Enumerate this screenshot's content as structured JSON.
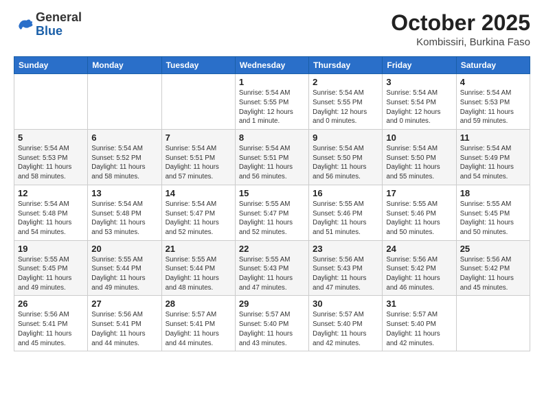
{
  "header": {
    "logo_general": "General",
    "logo_blue": "Blue",
    "month_title": "October 2025",
    "location": "Kombissiri, Burkina Faso"
  },
  "weekdays": [
    "Sunday",
    "Monday",
    "Tuesday",
    "Wednesday",
    "Thursday",
    "Friday",
    "Saturday"
  ],
  "weeks": [
    [
      {
        "day": "",
        "sunrise": "",
        "sunset": "",
        "daylight": ""
      },
      {
        "day": "",
        "sunrise": "",
        "sunset": "",
        "daylight": ""
      },
      {
        "day": "",
        "sunrise": "",
        "sunset": "",
        "daylight": ""
      },
      {
        "day": "1",
        "sunrise": "Sunrise: 5:54 AM",
        "sunset": "Sunset: 5:55 PM",
        "daylight": "Daylight: 12 hours and 1 minute."
      },
      {
        "day": "2",
        "sunrise": "Sunrise: 5:54 AM",
        "sunset": "Sunset: 5:55 PM",
        "daylight": "Daylight: 12 hours and 0 minutes."
      },
      {
        "day": "3",
        "sunrise": "Sunrise: 5:54 AM",
        "sunset": "Sunset: 5:54 PM",
        "daylight": "Daylight: 12 hours and 0 minutes."
      },
      {
        "day": "4",
        "sunrise": "Sunrise: 5:54 AM",
        "sunset": "Sunset: 5:53 PM",
        "daylight": "Daylight: 11 hours and 59 minutes."
      }
    ],
    [
      {
        "day": "5",
        "sunrise": "Sunrise: 5:54 AM",
        "sunset": "Sunset: 5:53 PM",
        "daylight": "Daylight: 11 hours and 58 minutes."
      },
      {
        "day": "6",
        "sunrise": "Sunrise: 5:54 AM",
        "sunset": "Sunset: 5:52 PM",
        "daylight": "Daylight: 11 hours and 58 minutes."
      },
      {
        "day": "7",
        "sunrise": "Sunrise: 5:54 AM",
        "sunset": "Sunset: 5:51 PM",
        "daylight": "Daylight: 11 hours and 57 minutes."
      },
      {
        "day": "8",
        "sunrise": "Sunrise: 5:54 AM",
        "sunset": "Sunset: 5:51 PM",
        "daylight": "Daylight: 11 hours and 56 minutes."
      },
      {
        "day": "9",
        "sunrise": "Sunrise: 5:54 AM",
        "sunset": "Sunset: 5:50 PM",
        "daylight": "Daylight: 11 hours and 56 minutes."
      },
      {
        "day": "10",
        "sunrise": "Sunrise: 5:54 AM",
        "sunset": "Sunset: 5:50 PM",
        "daylight": "Daylight: 11 hours and 55 minutes."
      },
      {
        "day": "11",
        "sunrise": "Sunrise: 5:54 AM",
        "sunset": "Sunset: 5:49 PM",
        "daylight": "Daylight: 11 hours and 54 minutes."
      }
    ],
    [
      {
        "day": "12",
        "sunrise": "Sunrise: 5:54 AM",
        "sunset": "Sunset: 5:48 PM",
        "daylight": "Daylight: 11 hours and 54 minutes."
      },
      {
        "day": "13",
        "sunrise": "Sunrise: 5:54 AM",
        "sunset": "Sunset: 5:48 PM",
        "daylight": "Daylight: 11 hours and 53 minutes."
      },
      {
        "day": "14",
        "sunrise": "Sunrise: 5:54 AM",
        "sunset": "Sunset: 5:47 PM",
        "daylight": "Daylight: 11 hours and 52 minutes."
      },
      {
        "day": "15",
        "sunrise": "Sunrise: 5:55 AM",
        "sunset": "Sunset: 5:47 PM",
        "daylight": "Daylight: 11 hours and 52 minutes."
      },
      {
        "day": "16",
        "sunrise": "Sunrise: 5:55 AM",
        "sunset": "Sunset: 5:46 PM",
        "daylight": "Daylight: 11 hours and 51 minutes."
      },
      {
        "day": "17",
        "sunrise": "Sunrise: 5:55 AM",
        "sunset": "Sunset: 5:46 PM",
        "daylight": "Daylight: 11 hours and 50 minutes."
      },
      {
        "day": "18",
        "sunrise": "Sunrise: 5:55 AM",
        "sunset": "Sunset: 5:45 PM",
        "daylight": "Daylight: 11 hours and 50 minutes."
      }
    ],
    [
      {
        "day": "19",
        "sunrise": "Sunrise: 5:55 AM",
        "sunset": "Sunset: 5:45 PM",
        "daylight": "Daylight: 11 hours and 49 minutes."
      },
      {
        "day": "20",
        "sunrise": "Sunrise: 5:55 AM",
        "sunset": "Sunset: 5:44 PM",
        "daylight": "Daylight: 11 hours and 49 minutes."
      },
      {
        "day": "21",
        "sunrise": "Sunrise: 5:55 AM",
        "sunset": "Sunset: 5:44 PM",
        "daylight": "Daylight: 11 hours and 48 minutes."
      },
      {
        "day": "22",
        "sunrise": "Sunrise: 5:55 AM",
        "sunset": "Sunset: 5:43 PM",
        "daylight": "Daylight: 11 hours and 47 minutes."
      },
      {
        "day": "23",
        "sunrise": "Sunrise: 5:56 AM",
        "sunset": "Sunset: 5:43 PM",
        "daylight": "Daylight: 11 hours and 47 minutes."
      },
      {
        "day": "24",
        "sunrise": "Sunrise: 5:56 AM",
        "sunset": "Sunset: 5:42 PM",
        "daylight": "Daylight: 11 hours and 46 minutes."
      },
      {
        "day": "25",
        "sunrise": "Sunrise: 5:56 AM",
        "sunset": "Sunset: 5:42 PM",
        "daylight": "Daylight: 11 hours and 45 minutes."
      }
    ],
    [
      {
        "day": "26",
        "sunrise": "Sunrise: 5:56 AM",
        "sunset": "Sunset: 5:41 PM",
        "daylight": "Daylight: 11 hours and 45 minutes."
      },
      {
        "day": "27",
        "sunrise": "Sunrise: 5:56 AM",
        "sunset": "Sunset: 5:41 PM",
        "daylight": "Daylight: 11 hours and 44 minutes."
      },
      {
        "day": "28",
        "sunrise": "Sunrise: 5:57 AM",
        "sunset": "Sunset: 5:41 PM",
        "daylight": "Daylight: 11 hours and 44 minutes."
      },
      {
        "day": "29",
        "sunrise": "Sunrise: 5:57 AM",
        "sunset": "Sunset: 5:40 PM",
        "daylight": "Daylight: 11 hours and 43 minutes."
      },
      {
        "day": "30",
        "sunrise": "Sunrise: 5:57 AM",
        "sunset": "Sunset: 5:40 PM",
        "daylight": "Daylight: 11 hours and 42 minutes."
      },
      {
        "day": "31",
        "sunrise": "Sunrise: 5:57 AM",
        "sunset": "Sunset: 5:40 PM",
        "daylight": "Daylight: 11 hours and 42 minutes."
      },
      {
        "day": "",
        "sunrise": "",
        "sunset": "",
        "daylight": ""
      }
    ]
  ]
}
